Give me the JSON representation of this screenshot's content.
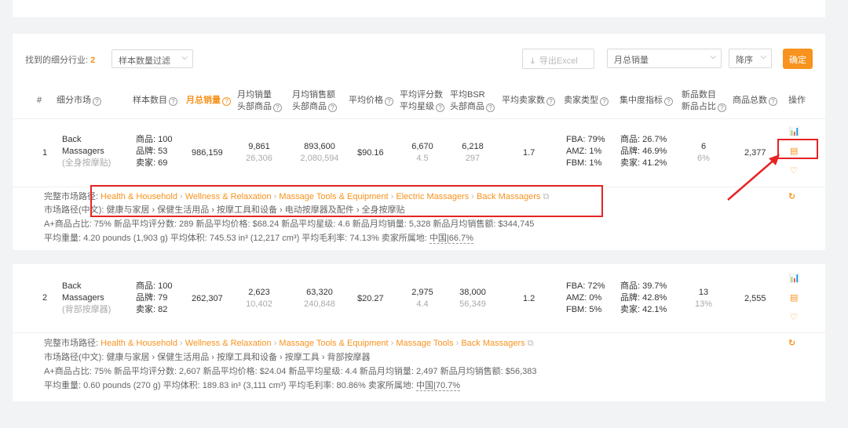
{
  "toolbar": {
    "found_label": "找到的细分行业:",
    "found_count": "2",
    "filter_select": "样本数量过滤",
    "export_label": "导出Excel",
    "sort_field": "月总销量",
    "sort_order": "降序",
    "confirm_label": "确定"
  },
  "header": {
    "index": "#",
    "market": "细分市场",
    "sample": "样本数目",
    "monthly_sales": "月总销量",
    "avg_sales_1": "月均销量",
    "avg_sales_2": "头部商品",
    "avg_revenue_1": "月均销售额",
    "avg_revenue_2": "头部商品",
    "avg_price": "平均价格",
    "avg_reviews_1": "平均评分数",
    "avg_reviews_2": "平均星级",
    "avg_bsr_1": "平均BSR",
    "avg_bsr_2": "头部商品",
    "avg_sellers": "平均卖家数",
    "seller_type": "卖家类型",
    "concentration": "集中度指标",
    "new_count_1": "新品数目",
    "new_count_2": "新品占比",
    "total_products": "商品总数",
    "actions": "操作"
  },
  "rows": [
    {
      "index": "1",
      "name_1": "Back",
      "name_2": "Massagers",
      "name_cn": "(全身按摩贴)",
      "sample_products": "商品: 100",
      "sample_brands": "品牌: 53",
      "sample_sellers": "卖家: 69",
      "monthly_sales": "986,159",
      "avg_sales": "9,861",
      "avg_sales_top": "26,306",
      "avg_revenue": "893,600",
      "avg_revenue_top": "2,080,594",
      "avg_price": "$90.16",
      "avg_reviews": "6,670",
      "avg_rating": "4.5",
      "avg_bsr": "6,218",
      "avg_bsr_top": "297",
      "avg_sellers": "1.7",
      "fba": "FBA: 79%",
      "amz": "AMZ: 1%",
      "fbm": "FBM: 1%",
      "conc_products": "商品: 26.7%",
      "conc_brands": "品牌: 46.9%",
      "conc_sellers": "卖家: 41.2%",
      "new_count": "6",
      "new_ratio": "6%",
      "total_products": "2,377",
      "path_label": "完整市场路径:",
      "path": [
        "Health & Household",
        "Wellness & Relaxation",
        "Massage Tools & Equipment",
        "Electric Massagers",
        "Back Massagers"
      ],
      "path_cn_label": "市场路径(中文):",
      "path_cn": "健康与家居 › 保健生活用品 › 按摩工具和设备 › 电动按摩器及配件 › 全身按摩贴",
      "stats1": "A+商品占比: 75%    新品平均评分数: 289    新品平均价格: $68.24    新品平均星级: 4.6    新品月均销量: 5,328    新品月均销售额: $344,745",
      "stats2_a": "平均重量: 4.20 pounds (1,903 g)    平均体积: 745.53 in³ (12,217 cm³)    平均毛利率: 74.13%    卖家所属地: ",
      "stats2_b": "中国|66.7%"
    },
    {
      "index": "2",
      "name_1": "Back",
      "name_2": "Massagers",
      "name_cn": "(背部按摩器)",
      "sample_products": "商品: 100",
      "sample_brands": "品牌: 79",
      "sample_sellers": "卖家: 82",
      "monthly_sales": "262,307",
      "avg_sales": "2,623",
      "avg_sales_top": "10,402",
      "avg_revenue": "63,320",
      "avg_revenue_top": "240,848",
      "avg_price": "$20.27",
      "avg_reviews": "2,975",
      "avg_rating": "4.4",
      "avg_bsr": "38,000",
      "avg_bsr_top": "56,349",
      "avg_sellers": "1.2",
      "fba": "FBA: 72%",
      "amz": "AMZ: 0%",
      "fbm": "FBM: 5%",
      "conc_products": "商品: 39.7%",
      "conc_brands": "品牌: 42.8%",
      "conc_sellers": "卖家: 42.1%",
      "new_count": "13",
      "new_ratio": "13%",
      "total_products": "2,555",
      "path_label": "完整市场路径:",
      "path": [
        "Health & Household",
        "Wellness & Relaxation",
        "Massage Tools & Equipment",
        "Massage Tools",
        "Back Massagers"
      ],
      "path_cn_label": "市场路径(中文):",
      "path_cn": "健康与家居 › 保健生活用品 › 按摩工具和设备 › 按摩工具 › 背部按摩器",
      "stats1": "A+商品占比: 75%    新品平均评分数: 2,607    新品平均价格: $24.04    新品平均星级: 4.4    新品月均销量: 2,497    新品月均销售额: $56,383",
      "stats2_a": "平均重量: 0.60 pounds (270 g)    平均体积: 189.83 in³ (3,111 cm³)    平均毛利率: 80.86%    卖家所属地: ",
      "stats2_b": "中国|70.7%"
    }
  ],
  "icons": {
    "chart": "bar-chart-icon",
    "detail": "document-icon",
    "favorite": "heart-icon",
    "refresh": "refresh-icon",
    "external": "external-link-icon"
  },
  "colors": {
    "accent": "#f7931e",
    "highlight_box": "#e52424"
  }
}
